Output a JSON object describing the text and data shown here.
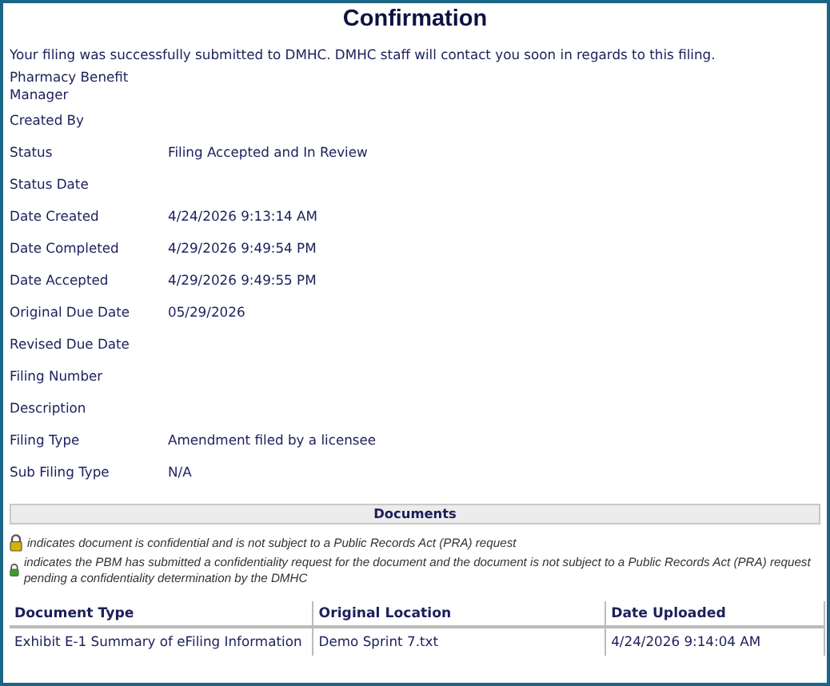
{
  "title": "Confirmation",
  "message": "Your filing was successfully submitted to DMHC. DMHC staff will contact you soon in regards to this filing.",
  "fields": [
    {
      "label": "Pharmacy Benefit Manager"
    },
    {
      "label": "Created By"
    },
    {
      "label": "Status",
      "value": "Filing Accepted and In Review"
    },
    {
      "label": "Status Date"
    },
    {
      "label": "Date Created",
      "value": "4/24/2026 9:13:14 AM"
    },
    {
      "label": "Date Completed",
      "value": "4/29/2026 9:49:54 PM"
    },
    {
      "label": "Date Accepted",
      "value": "4/29/2026 9:49:55 PM"
    },
    {
      "label": "Original Due Date",
      "value": "05/29/2026"
    },
    {
      "label": "Revised Due Date"
    },
    {
      "label": "Filing Number"
    },
    {
      "label": "Description"
    },
    {
      "label": "Filing Type",
      "value": "Amendment filed by a licensee"
    },
    {
      "label": "Sub Filing Type",
      "value": "N/A"
    }
  ],
  "documents": {
    "heading": "Documents",
    "legend": [
      {
        "color": "#d4b400",
        "text": "indicates document is confidential and is not subject to a Public Records Act (PRA) request"
      },
      {
        "color": "#3c9c2c",
        "text": "indicates the PBM has submitted a confidentiality request for the document and the document is not subject to a Public Records Act (PRA) request pending a confidentiality determination by the DMHC"
      }
    ],
    "table": {
      "columns": [
        "Document Type",
        "Original Location",
        "Date Uploaded"
      ],
      "rows": [
        [
          "Exhibit E-1 Summary of eFiling Information",
          "Demo Sprint 7.txt",
          "4/24/2026 9:14:04 AM"
        ]
      ]
    }
  }
}
